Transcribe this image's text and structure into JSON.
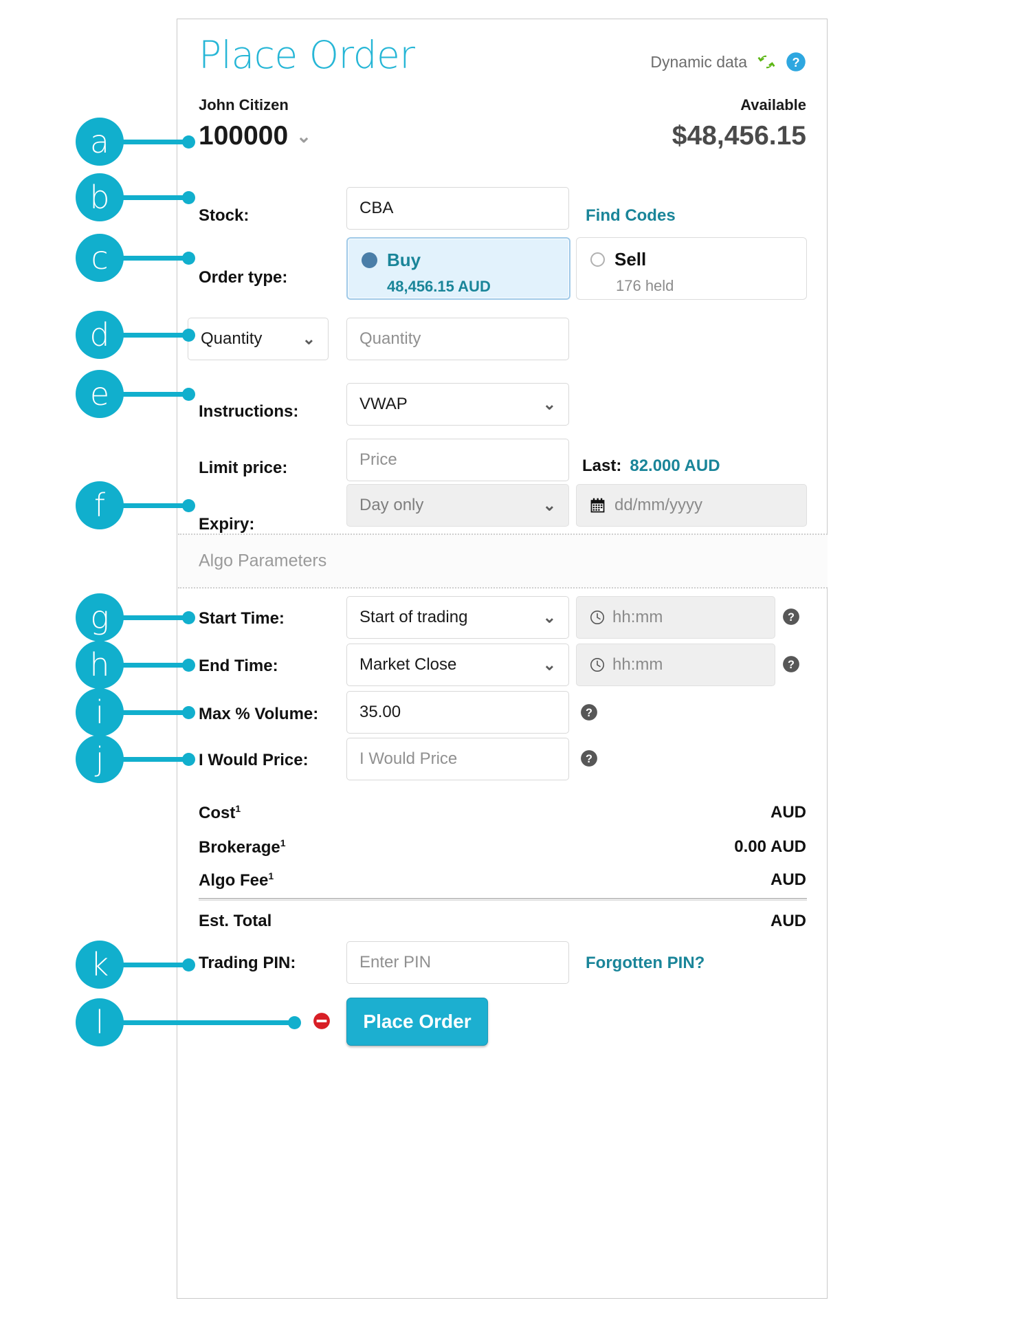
{
  "header": {
    "title": "Place Order",
    "dynamic_data_label": "Dynamic data",
    "refresh_icon": "refresh-icon",
    "help_icon": "help-circle-icon"
  },
  "account": {
    "holder_name": "John Citizen",
    "account_number": "100000",
    "available_label": "Available",
    "available_amount": "$48,456.15"
  },
  "stock": {
    "label": "Stock:",
    "value": "CBA",
    "find_codes_link": "Find Codes"
  },
  "order_type": {
    "label": "Order type:",
    "buy": {
      "name": "Buy",
      "sub": "48,456.15 AUD",
      "selected": true
    },
    "sell": {
      "name": "Sell",
      "sub": "176 held",
      "selected": false
    }
  },
  "quantity": {
    "mode_label": "Quantity",
    "input_placeholder": "Quantity",
    "input_value": ""
  },
  "instructions": {
    "label": "Instructions:",
    "value": "VWAP"
  },
  "limit_price": {
    "label": "Limit price:",
    "placeholder": "Price",
    "last_label": "Last:",
    "last_value": "82.000 AUD"
  },
  "expiry": {
    "label": "Expiry:",
    "value": "Day only",
    "date_placeholder": "dd/mm/yyyy"
  },
  "algo_section": {
    "heading": "Algo Parameters"
  },
  "start_time": {
    "label": "Start Time:",
    "value": "Start of trading",
    "time_placeholder": "hh:mm"
  },
  "end_time": {
    "label": "End Time:",
    "value": "Market Close",
    "time_placeholder": "hh:mm"
  },
  "max_volume": {
    "label": "Max % Volume:",
    "value": "35.00"
  },
  "i_would_price": {
    "label": "I Would Price:",
    "placeholder": "I Would Price"
  },
  "summary": {
    "rows": [
      {
        "label": "Cost",
        "sup": "1",
        "value": "",
        "currency": "AUD"
      },
      {
        "label": "Brokerage",
        "sup": "1",
        "value": "0.00",
        "currency": "AUD"
      },
      {
        "label": "Algo Fee",
        "sup": "1",
        "value": "",
        "currency": "AUD"
      }
    ],
    "total": {
      "label": "Est. Total",
      "value": "",
      "currency": "AUD"
    }
  },
  "trading_pin": {
    "label": "Trading PIN:",
    "placeholder": "Enter PIN",
    "forgotten_link": "Forgotten PIN?"
  },
  "submit": {
    "button_label": "Place Order",
    "status_icon": "no-entry-icon"
  },
  "annotations": [
    {
      "letter": "a"
    },
    {
      "letter": "b"
    },
    {
      "letter": "c"
    },
    {
      "letter": "d"
    },
    {
      "letter": "e"
    },
    {
      "letter": "f"
    },
    {
      "letter": "g"
    },
    {
      "letter": "h"
    },
    {
      "letter": "i"
    },
    {
      "letter": "j"
    },
    {
      "letter": "k"
    },
    {
      "letter": "l"
    }
  ],
  "colors": {
    "accent_teal": "#11AFCD",
    "title_teal": "#26B6D6",
    "link_teal": "#1A8599",
    "buy_panel_bg": "#E2F2FC",
    "buy_panel_border": "#9FC9E8",
    "radio_selected": "#4A7EA8",
    "button_bg": "#1CAFD0",
    "refresh_green": "#5CB615",
    "help_blue": "#2EA7E0",
    "no_entry_red": "#D81F26"
  }
}
